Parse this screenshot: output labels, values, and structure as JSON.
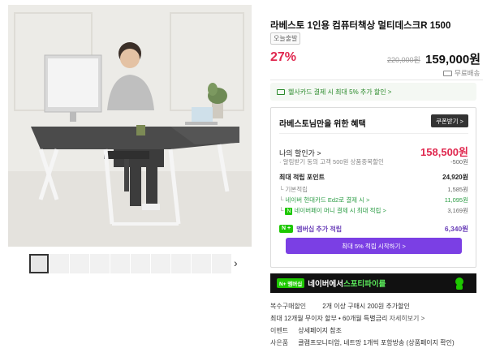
{
  "product": {
    "title": "라베스토 1인용 컴퓨터책상 멀티데스크R 1500",
    "today_badge": "오늘출발",
    "discount": "27%",
    "original_price": "220,000원",
    "sale_price": "159,000원",
    "shipping": "무료배송"
  },
  "card_promo": {
    "text": "헬사카드 결제 시 최대 5% 추가 할인 >"
  },
  "benefits": {
    "title": "라베스토님만을 위한 혜택",
    "coupon_button": "쿠폰받기 >",
    "my_price_label": "나의 할인가 >",
    "my_price_value": "158,500원",
    "coupon_note_label": "· 알림받기 동의 고객 500원 상품중복할인",
    "coupon_note_value": "-500원",
    "points_label": "최대 적립 포인트",
    "points_value": "24,920원",
    "basic_label": "기본적립",
    "basic_value": "1,585원",
    "hyundai_label": "네이버 현대카드 Ed2로 결제 시 >",
    "hyundai_value": "11,095원",
    "money_label": "네이버페이 머니 결제 시 최대 적립 >",
    "money_value": "3,169원",
    "member_label": "멤버십 추가 적립",
    "member_plus": "N +",
    "member_value": "6,340원",
    "member_button": "최대 5% 적립 시작하기 >"
  },
  "banner": {
    "badge": "N+ 멤버십",
    "text_prefix": "네이버에서 ",
    "text_highlight": "스포티파이를"
  },
  "info": {
    "bundle_label": "복수구매할인",
    "bundle_value": "2개 이상 구매시 200원 추가할인",
    "installment_value": "최대 12개월 무이자 할부 • 60개월 특별금리",
    "installment_link": "자세히보기 >",
    "event_label": "이벤트",
    "event_value": "상세페이지 참조",
    "gift_label": "사은품",
    "gift_value": "클램프모니터암, 네트망 1개씩 포함방송 (상품페이지 확인)"
  },
  "colors": {
    "accent_red": "#e0284f",
    "naver_green": "#1ec800",
    "membership_purple": "#7b3fe4"
  },
  "icons": {
    "thumb_next": "chevron-right-icon",
    "shipping": "truck-icon",
    "card": "credit-card-icon"
  }
}
